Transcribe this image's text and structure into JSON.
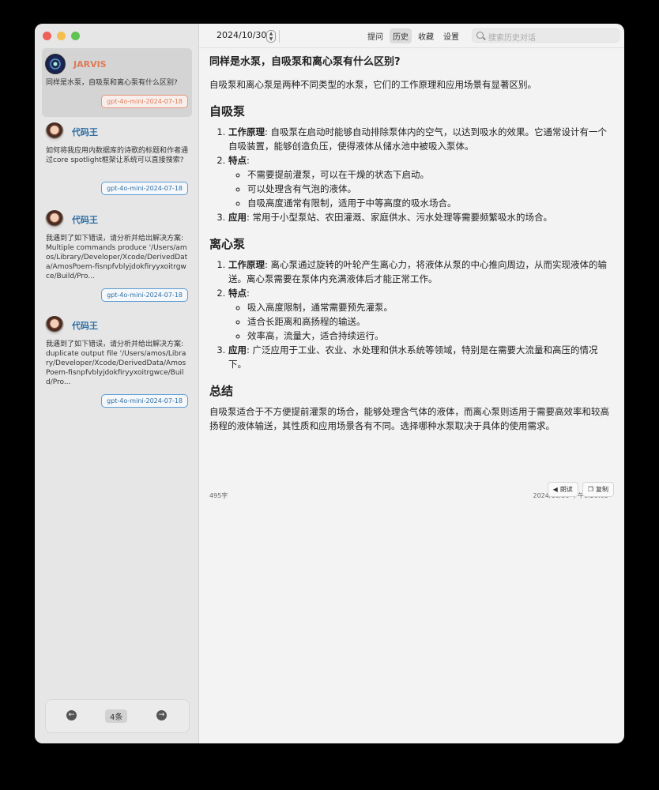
{
  "toolbar": {
    "date": "2024/10/30",
    "tabs": [
      "提问",
      "历史",
      "收藏",
      "设置"
    ],
    "selected_tab": "历史",
    "search_placeholder": "搜索历史对话"
  },
  "sidebar": {
    "conversations": [
      {
        "name": "JARVIS",
        "preview": "同样是水泵，自吸泵和离心泵有什么区别?",
        "model": "gpt-4o-mini-2024-07-18",
        "active": true
      },
      {
        "name": "代码王",
        "preview": "如何将我应用内数据库的诗歌的标题和作者通过core spotlight框架让系统可以直接搜索?",
        "model": "gpt-4o-mini-2024-07-18"
      },
      {
        "name": "代码王",
        "preview": "我遇到了如下错误，请分析并给出解决方案: Multiple commands produce '/Users/amos/Library/Developer/Xcode/DerivedData/AmosPoem-fisnpfvblyjdokfiryyxoitrgwce/Build/Pro...",
        "model": "gpt-4o-mini-2024-07-18"
      },
      {
        "name": "代码王",
        "preview": "我遇到了如下错误，请分析并给出解决方案: duplicate output file '/Users/amos/Library/Developer/Xcode/DerivedData/AmosPoem-fisnpfvblyjdokfiryyxoitrgwce/Build/Pro...",
        "model": "gpt-4o-mini-2024-07-18"
      }
    ],
    "pager": {
      "count_label": "4条"
    }
  },
  "content": {
    "question": "同样是水泵，自吸泵和离心泵有什么区别?",
    "intro": "自吸泵和离心泵是两种不同类型的水泵，它们的工作原理和应用场景有显著区别。",
    "sections": [
      {
        "heading": "自吸泵",
        "items": [
          {
            "label": "工作原理",
            "text": ": 自吸泵在启动时能够自动排除泵体内的空气，以达到吸水的效果。它通常设计有一个自吸装置，能够创造负压，使得液体从储水池中被吸入泵体。"
          },
          {
            "label": "特点",
            "text": ":",
            "sub": [
              "不需要提前灌泵，可以在干燥的状态下启动。",
              "可以处理含有气泡的液体。",
              "自吸高度通常有限制，适用于中等高度的吸水场合。"
            ]
          },
          {
            "label": "应用",
            "text": ": 常用于小型泵站、农田灌溉、家庭供水、污水处理等需要频繁吸水的场合。"
          }
        ]
      },
      {
        "heading": "离心泵",
        "items": [
          {
            "label": "工作原理",
            "text": ": 离心泵通过旋转的叶轮产生离心力，将液体从泵的中心推向周边，从而实现液体的输送。离心泵需要在泵体内充满液体后才能正常工作。"
          },
          {
            "label": "特点",
            "text": ":",
            "sub": [
              "吸入高度限制，通常需要预先灌泵。",
              "适合长距离和高扬程的输送。",
              "效率高，流量大，适合持续运行。"
            ]
          },
          {
            "label": "应用",
            "text": ": 广泛应用于工业、农业、水处理和供水系统等领域，特别是在需要大流量和高压的情况下。"
          }
        ]
      }
    ],
    "summary_heading": "总结",
    "summary": "自吸泵适合于不方便提前灌泵的场合，能够处理含气体的液体，而离心泵则适用于需要高效率和较高扬程的液体输送，其性质和应用场景各有不同。选择哪种水泵取决于具体的使用需求。",
    "word_count": "495字",
    "timestamp": "2024/10/30 下午6:20:05",
    "read_label": "朗读",
    "copy_label": "复制"
  }
}
